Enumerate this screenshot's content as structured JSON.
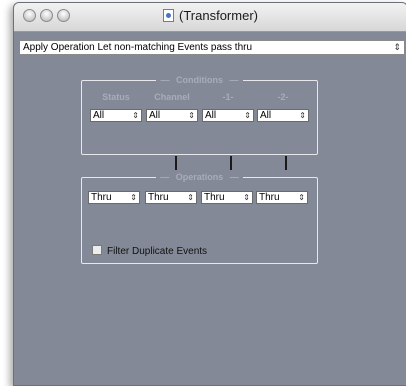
{
  "window": {
    "title": "(Transformer)"
  },
  "apply_operation": {
    "label": "Apply Operation",
    "value": "Let non-matching Events pass thru"
  },
  "conditions": {
    "legend": "Conditions",
    "columns": [
      {
        "label": "Status",
        "value": "All"
      },
      {
        "label": "Channel",
        "value": "All"
      },
      {
        "label": "-1-",
        "value": "All"
      },
      {
        "label": "-2-",
        "value": "All"
      }
    ]
  },
  "operations": {
    "legend": "Operations",
    "values": [
      "Thru",
      "Thru",
      "Thru",
      "Thru"
    ]
  },
  "filter_duplicates": {
    "label": "Filter Duplicate Events",
    "checked": false
  },
  "icons": {
    "popup_arrows": "updown-arrows-icon",
    "document": "document-icon"
  }
}
